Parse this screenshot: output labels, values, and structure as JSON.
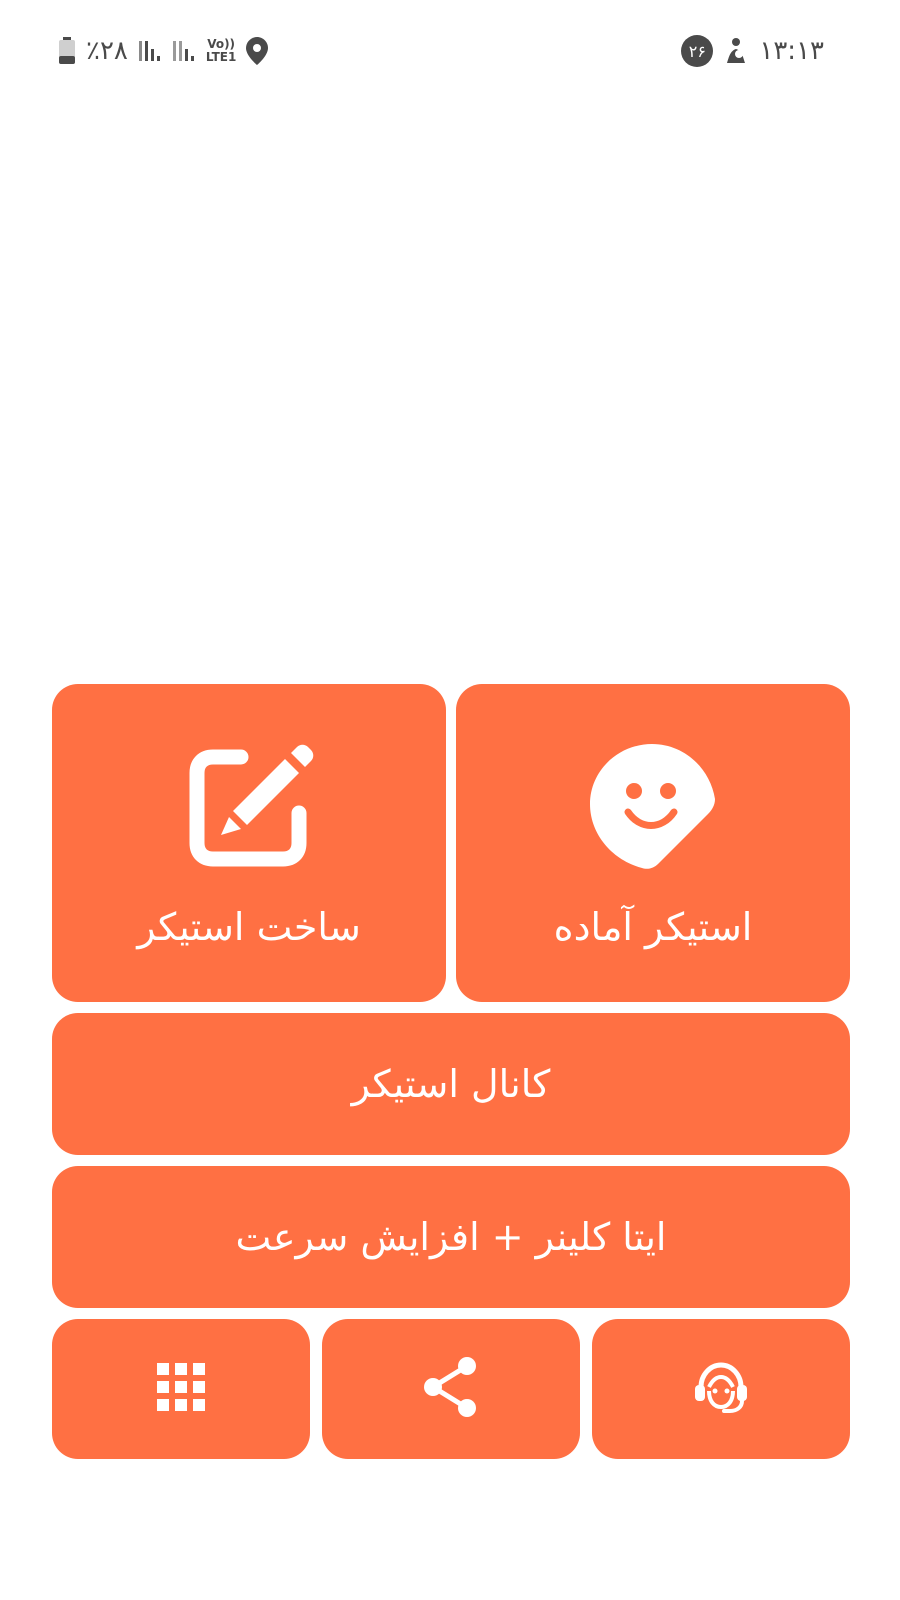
{
  "status_bar": {
    "time": "۱۳:۱۳",
    "notification_count": "۲۶",
    "battery_percent": "٪۲۸",
    "network_label_top": "Vo))",
    "network_label_bottom": "LTE1",
    "icons": [
      "location-icon",
      "signal-icon",
      "battery-icon",
      "notification-badge",
      "app-notification-icon"
    ]
  },
  "tiles": {
    "ready_sticker": {
      "label": "استیکر آماده",
      "icon": "sticker-smiley-icon"
    },
    "make_sticker": {
      "label": "ساخت استیکر",
      "icon": "edit-pencil-icon"
    },
    "sticker_channel": {
      "label": "کانال استیکر"
    },
    "cleaner": {
      "label": "ایتا کلینر + افزایش سرعت"
    },
    "support": {
      "icon": "support-headset-icon"
    },
    "share": {
      "icon": "share-icon"
    },
    "more_apps": {
      "icon": "apps-grid-icon"
    }
  },
  "colors": {
    "tile_background": "#ff7043",
    "tile_foreground": "#ffffff",
    "page_background": "#ffffff",
    "status_icons": "#4a4a4a"
  }
}
